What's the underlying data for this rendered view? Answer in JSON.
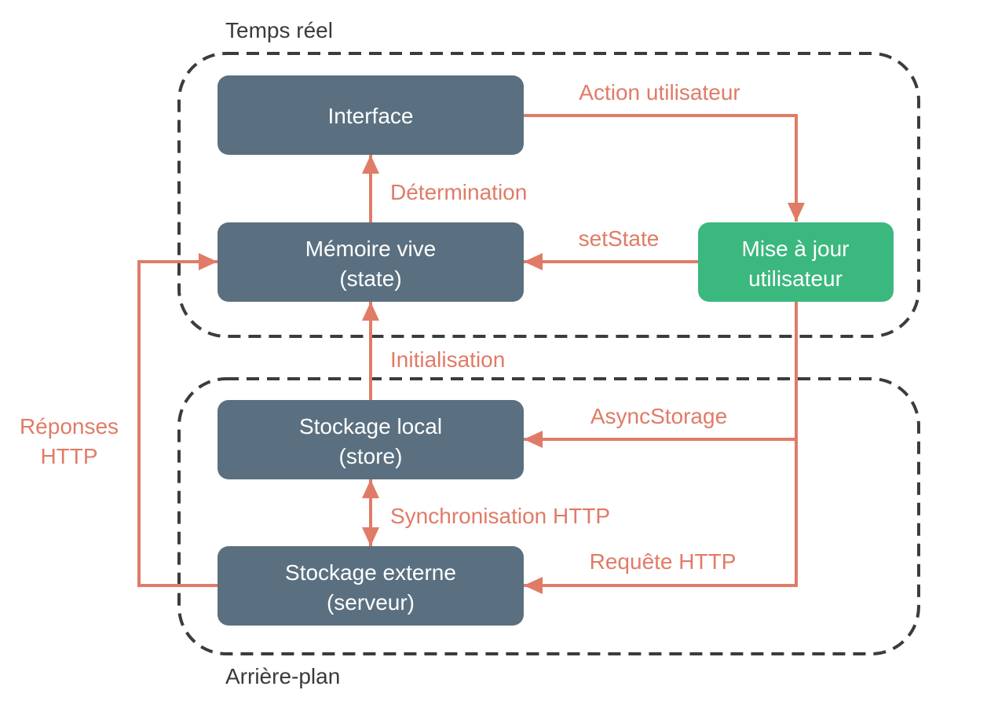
{
  "colors": {
    "node": "#5a7080",
    "node_highlight": "#3bb87e",
    "edge": "#e07b67",
    "group_border": "#3c3c3c"
  },
  "groups": {
    "realtime": "Temps réel",
    "background": "Arrière-plan"
  },
  "nodes": {
    "interface": [
      "Interface"
    ],
    "memory": [
      "Mémoire vive",
      "(state)"
    ],
    "user_update": [
      "Mise à jour",
      "utilisateur"
    ],
    "local_storage": [
      "Stockage local",
      "(store)"
    ],
    "external_storage": [
      "Stockage externe",
      "(serveur)"
    ]
  },
  "edges": {
    "user_action": "Action utilisateur",
    "determination": "Détermination",
    "set_state": "setState",
    "initialisation": "Initialisation",
    "async_storage": "AsyncStorage",
    "http_sync": "Synchronisation HTTP",
    "http_request": "Requête HTTP",
    "http_responses": [
      "Réponses",
      "HTTP"
    ]
  }
}
